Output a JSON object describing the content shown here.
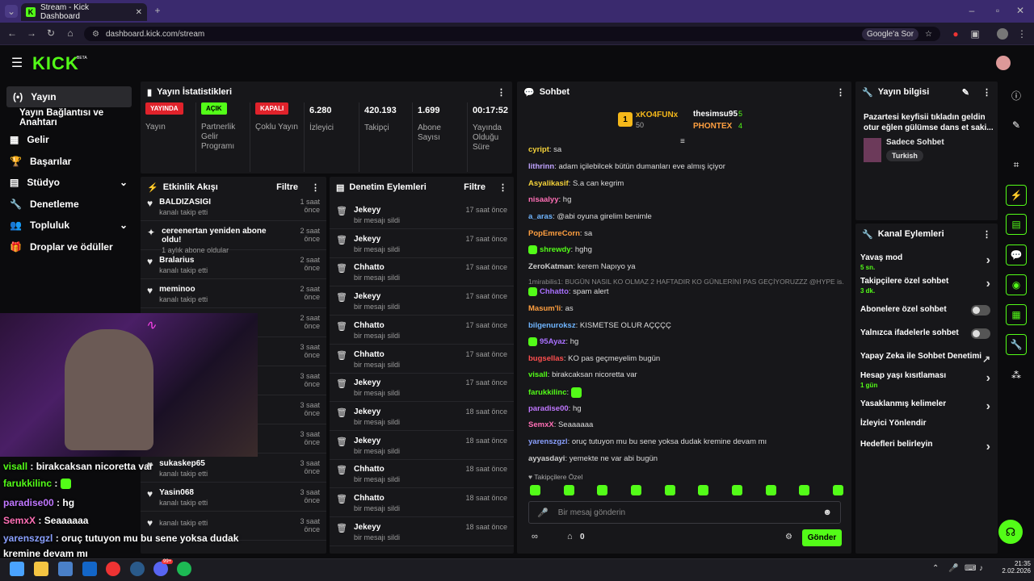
{
  "browser": {
    "tab_title": "Stream - Kick Dashboard",
    "url": "dashboard.kick.com/stream",
    "google_btn": "Google'a Sor",
    "new_tab": "+"
  },
  "header": {
    "logo": "KICK",
    "beta": "BETA"
  },
  "sidebar": {
    "items": [
      {
        "label": "Yayın",
        "icon": "stream-icon"
      },
      {
        "label": "Yayın Bağlantısı ve Anahtarı",
        "icon": ""
      },
      {
        "label": "Gelir",
        "icon": "revenue-icon"
      },
      {
        "label": "Başarılar",
        "icon": "trophy-icon"
      },
      {
        "label": "Stüdyo",
        "icon": "studio-icon"
      },
      {
        "label": "Denetleme",
        "icon": "wrench-icon"
      },
      {
        "label": "Topluluk",
        "icon": "community-icon"
      },
      {
        "label": "Droplar ve ödüller",
        "icon": "gift-icon"
      }
    ]
  },
  "stats": {
    "title": "Yayın İstatistikleri",
    "cols": [
      {
        "badge": "YAYINDA",
        "label": "Yayın",
        "color": "#e0222b"
      },
      {
        "badge": "AÇIK",
        "label": "Partnerlik Gelir Programı",
        "color": "#53fc18"
      },
      {
        "badge": "KAPALI",
        "label": "Çoklu Yayın",
        "color": "#e0222b"
      },
      {
        "value": "6.280",
        "label": "İzleyici"
      },
      {
        "value": "420.193",
        "label": "Takipçi"
      },
      {
        "value": "1.699",
        "label": "Abone Sayısı"
      },
      {
        "value": "00:17:52",
        "label": "Yayında Olduğu Süre"
      }
    ]
  },
  "activity": {
    "title": "Etkinlik Akışı",
    "filter": "Filtre",
    "rows": [
      {
        "name": "BALDIZASIGI",
        "desc": "kanalı takip etti",
        "time": "1 saat önce"
      },
      {
        "name": "cereenertan yeniden abone oldu!",
        "desc": "1 aylık abone oldular",
        "time": "2 saat önce"
      },
      {
        "name": "Bralarius",
        "desc": "kanalı takip etti",
        "time": "2 saat önce"
      },
      {
        "name": "meminoo",
        "desc": "kanalı takip etti",
        "time": "2 saat önce"
      },
      {
        "name": "",
        "desc": "",
        "time": "2 saat önce"
      },
      {
        "name": "",
        "desc": "",
        "time": "3 saat önce"
      },
      {
        "name": "",
        "desc": "",
        "time": "3 saat önce"
      },
      {
        "name": "",
        "desc": "",
        "time": "3 saat önce"
      },
      {
        "name": "one",
        "desc": "1 aylık abone oldular",
        "time": "3 saat önce"
      },
      {
        "name": "sukaskep65",
        "desc": "kanalı takip etti",
        "time": "3 saat önce"
      },
      {
        "name": "Yasin068",
        "desc": "kanalı takip etti",
        "time": "3 saat önce"
      },
      {
        "name": "",
        "desc": "kanalı takip etti",
        "time": "3 saat önce"
      }
    ]
  },
  "moderation": {
    "title": "Denetim Eylemleri",
    "filter": "Filtre",
    "rows": [
      {
        "name": "Jekeyy",
        "desc": "bir mesajı sildi",
        "time": "17 saat önce"
      },
      {
        "name": "Jekeyy",
        "desc": "bir mesajı sildi",
        "time": "17 saat önce"
      },
      {
        "name": "Chhatto",
        "desc": "bir mesajı sildi",
        "time": "17 saat önce"
      },
      {
        "name": "Jekeyy",
        "desc": "bir mesajı sildi",
        "time": "17 saat önce"
      },
      {
        "name": "Chhatto",
        "desc": "bir mesajı sildi",
        "time": "17 saat önce"
      },
      {
        "name": "Chhatto",
        "desc": "bir mesajı sildi",
        "time": "17 saat önce"
      },
      {
        "name": "Jekeyy",
        "desc": "bir mesajı sildi",
        "time": "17 saat önce"
      },
      {
        "name": "Jekeyy",
        "desc": "bir mesajı sildi",
        "time": "18 saat önce"
      },
      {
        "name": "Jekeyy",
        "desc": "bir mesajı sildi",
        "time": "18 saat önce"
      },
      {
        "name": "Chhatto",
        "desc": "bir mesajı sildi",
        "time": "18 saat önce"
      },
      {
        "name": "Chhatto",
        "desc": "bir mesajı sildi",
        "time": "18 saat önce"
      },
      {
        "name": "Jekeyy",
        "desc": "bir mesajı sildi",
        "time": "18 saat önce"
      }
    ]
  },
  "chat": {
    "title": "Sohbet",
    "leaders": [
      {
        "rank": "1",
        "name": "xKO4FUNx",
        "count": "50"
      },
      {
        "name": "thesimsu95",
        "count": "5"
      },
      {
        "name": "PHONTEX",
        "count": "4"
      }
    ],
    "messages": [
      {
        "user": "cyript",
        "text": "sa",
        "color": "#f5d33a"
      },
      {
        "user": "lithrinn",
        "text": "adam içilebilcek bütün dumanları eve almış içiyor",
        "color": "#c0a3ff"
      },
      {
        "user": "Asyalikasif",
        "text": "S.a can kegrim",
        "color": "#f5d33a"
      },
      {
        "user": "nisaalyy",
        "text": "hg",
        "color": "#ff6fb5"
      },
      {
        "user": "a_aras",
        "text": "@abi oyuna girelim benimle",
        "color": "#6fb5ff"
      },
      {
        "user": "PopEmreCorn",
        "text": "sa",
        "color": "#ff9f40"
      },
      {
        "user": "shrewdy",
        "text": "hghg",
        "color": "#53fc18"
      },
      {
        "user": "ZeroKatman",
        "text": "kerem Napıyo ya",
        "color": "#cfcfcf"
      },
      {
        "user": "",
        "text": "1mirabilis1: BUGÜN NASIL KO OLMAZ 2 HAFTADIR KO GÜNLERİNİ PAS GEÇİYORUZZZ @HYPE is...",
        "color": "#888"
      },
      {
        "user": "Chhatto",
        "text": "spam alert",
        "color": "#a970ff"
      },
      {
        "user": "Masum'li",
        "text": "as",
        "color": "#ff9f40"
      },
      {
        "user": "bilgenuroksz",
        "text": "KISMETSE OLUR AÇÇÇÇ",
        "color": "#6fb5ff"
      },
      {
        "user": "95Ayaz",
        "text": "hg",
        "color": "#a970ff"
      },
      {
        "user": "bugsellas",
        "text": "KO pas geçmeyelim bugün",
        "color": "#ff4f4f"
      },
      {
        "user": "visall",
        "text": "birakcaksan nicoretta var",
        "color": "#53fc18"
      },
      {
        "user": "farukkilinc",
        "text": "",
        "color": "#53fc18"
      },
      {
        "user": "paradise00",
        "text": "hg",
        "color": "#c077ff"
      },
      {
        "user": "SemxX",
        "text": "Seaaaaaa",
        "color": "#ff6fb5"
      },
      {
        "user": "yarenszgzl",
        "text": "oruç tutuyon mu bu sene yoksa dudak kremine devam mı",
        "color": "#8aa0ff"
      },
      {
        "user": "ayyasdayi",
        "text": "yemekte ne var abi bugün",
        "color": "#cfcfcf"
      }
    ],
    "followers_label": "Takipçilere Özel",
    "placeholder": "Bir mesaj gönderin",
    "count": "0",
    "send": "Gönder"
  },
  "stream_info": {
    "title": "Yayın bilgisi",
    "desc": "Pazartesi keyfisii tıkladın geldin otur eğlen gülümse dans et saki...",
    "category": "Sadece Sohbet",
    "tag": "Turkish"
  },
  "channel_actions": {
    "title": "Kanal Eylemleri",
    "items": [
      {
        "label": "Yavaş mod",
        "sub": "5 sn.",
        "type": "chev"
      },
      {
        "label": "Takipçilere özel sohbet",
        "sub": "3 dk.",
        "type": "chev"
      },
      {
        "label": "Abonelere özel sohbet",
        "sub": "",
        "type": "toggle"
      },
      {
        "label": "Yalnızca ifadelerle sohbet",
        "sub": "",
        "type": "toggle"
      },
      {
        "label": "Yapay Zeka ile Sohbet Denetimi",
        "sub": "",
        "type": "ext"
      },
      {
        "label": "Hesap yaşı kısıtlaması",
        "sub": "1 gün",
        "type": "chev"
      },
      {
        "label": "Yasaklanmış kelimeler",
        "sub": "",
        "type": "chev"
      },
      {
        "label": "İzleyici Yönlendir",
        "sub": "",
        "type": "none"
      },
      {
        "label": "Hedefleri belirleyin",
        "sub": "",
        "type": "chev"
      }
    ]
  },
  "overlay": [
    {
      "user": "visall",
      "text": " : birakcaksan nicoretta var",
      "color": "#53fc18"
    },
    {
      "user": "farukkilinc",
      "text": " :",
      "color": "#53fc18"
    },
    {
      "user": "paradise00",
      "text": " : hg",
      "color": "#c077ff"
    },
    {
      "user": "SemxX",
      "text": " : Seaaaaaa",
      "color": "#ff6fb5"
    },
    {
      "user": "yarenszgzl",
      "text": " : oruç tutuyon mu bu sene yoksa dudak",
      "color": "#8aa0ff"
    },
    {
      "user": "",
      "text": "kremine devam mı",
      "color": "#ffffff"
    }
  ],
  "taskbar": {
    "time": "21:35",
    "date": "2.02.2026",
    "badge": "99+"
  }
}
